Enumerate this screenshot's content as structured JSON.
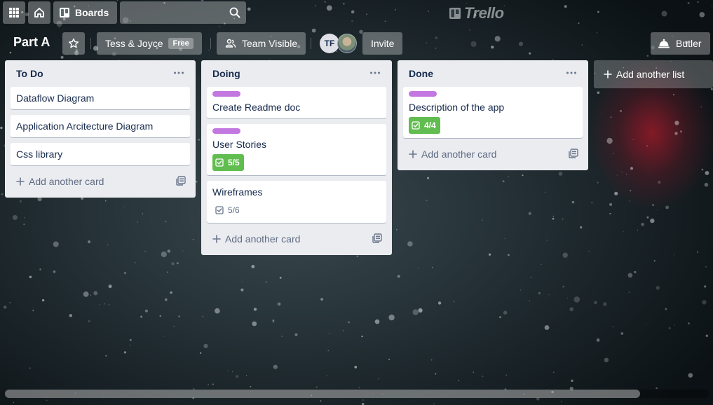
{
  "header": {
    "boards_label": "Boards",
    "search_value": "",
    "logo_text": "Trello"
  },
  "board": {
    "title": "Part A",
    "team_name": "Tess & Joyce",
    "team_badge": "Free",
    "visibility": "Team Visible",
    "member_initials": "TF",
    "invite_label": "Invite",
    "butler_label": "Butler"
  },
  "lists": [
    {
      "title": "To Do",
      "menu": "…",
      "add_card": "Add another card",
      "cards": [
        {
          "title": "Dataflow Diagram"
        },
        {
          "title": "Application Arcitecture Diagram"
        },
        {
          "title": "Css library"
        }
      ]
    },
    {
      "title": "Doing",
      "menu": "…",
      "add_card": "Add another card",
      "cards": [
        {
          "title": "Create Readme doc",
          "label_color": "#c377e0"
        },
        {
          "title": "User Stories",
          "label_color": "#c377e0",
          "checklist": "5/5",
          "checklist_complete": true
        },
        {
          "title": "Wireframes",
          "checklist": "5/6",
          "checklist_complete": false
        }
      ]
    },
    {
      "title": "Done",
      "menu": "…",
      "add_card": "Add another card",
      "cards": [
        {
          "title": "Description of the app",
          "label_color": "#c377e0",
          "checklist": "4/4",
          "checklist_complete": true
        }
      ]
    }
  ],
  "add_list_label": "Add another list",
  "icons": {
    "apps": "grid-icon",
    "home": "home-icon",
    "boards": "board-icon",
    "search": "search-icon",
    "star": "star-icon",
    "visibility": "team-icon",
    "butler": "bell-icon",
    "checklist": "checklist-icon",
    "template": "template-icon",
    "plus": "plus-icon"
  },
  "colors": {
    "list_bg": "#ebecf0",
    "label_purple": "#c377e0",
    "badge_green": "#61bd4f",
    "text_primary": "#172b4d",
    "text_muted": "#5e6c84"
  }
}
